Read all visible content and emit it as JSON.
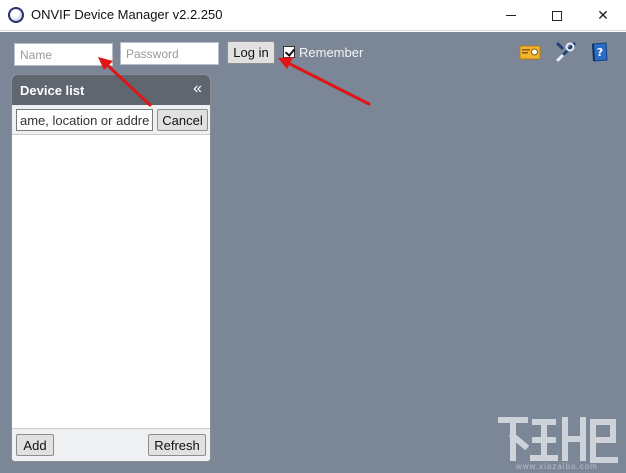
{
  "window": {
    "title": "ONVIF Device Manager v2.2.250",
    "controls": {
      "minimize": "minimize",
      "maximize": "maximize",
      "close": "✕"
    }
  },
  "login": {
    "name_placeholder": "Name",
    "password_placeholder": "Password",
    "login_label": "Log in",
    "remember_label": "Remember",
    "remember_checked": true
  },
  "toolbar_icons": [
    "certificate-icon",
    "tools-icon",
    "help-book-icon"
  ],
  "device_list": {
    "title": "Device list",
    "collapse_glyph": "«",
    "search_placeholder": "ame, location or addres",
    "cancel_label": "Cancel",
    "add_label": "Add",
    "refresh_label": "Refresh"
  },
  "watermark": {
    "url_text": "www.xiazaiba.com"
  },
  "colors": {
    "workspace": "#7b8796",
    "panel_header": "#5f6670",
    "annotation_arrow": "#e01515"
  }
}
